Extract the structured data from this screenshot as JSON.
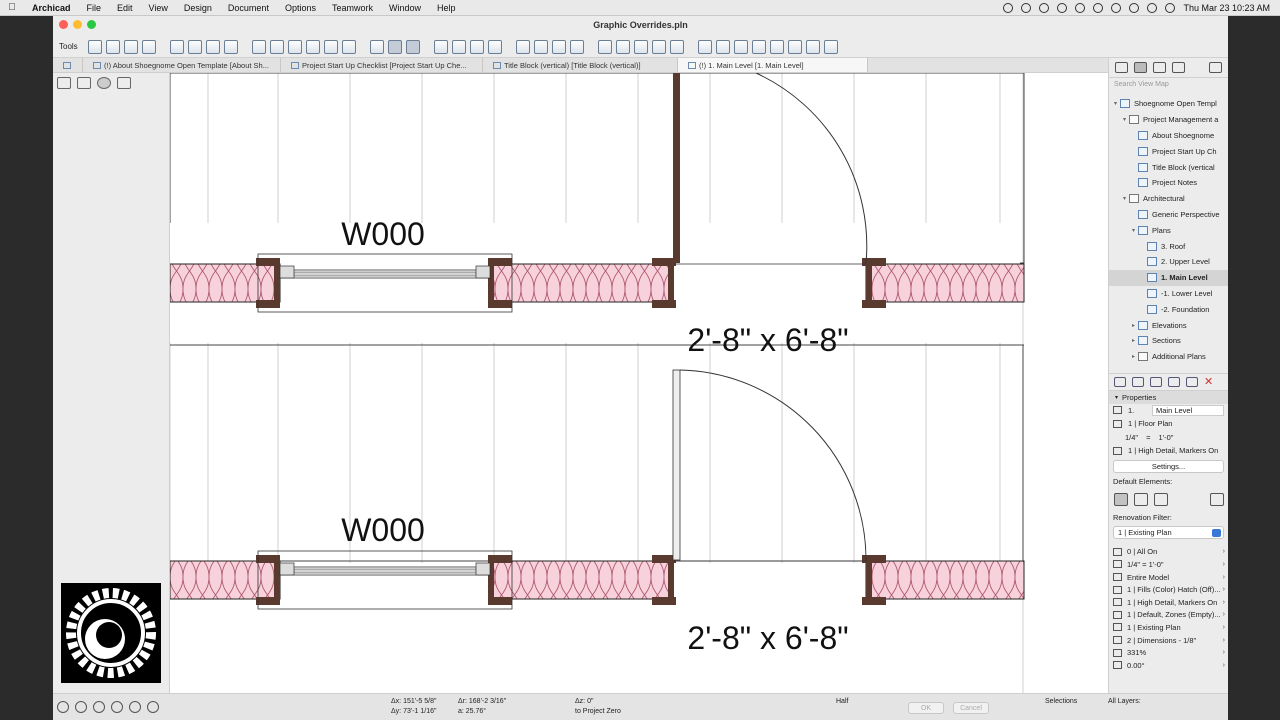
{
  "menubar": {
    "app": "Archicad",
    "items": [
      "File",
      "Edit",
      "View",
      "Design",
      "Document",
      "Options",
      "Teamwork",
      "Window",
      "Help"
    ],
    "clock": "Thu Mar 23  10:23 AM"
  },
  "window": {
    "title": "Graphic Overrides.pln"
  },
  "toolbar": {
    "tools_label": "Tools"
  },
  "tabs": [
    "(!) About Shoegnome Open Template [About Sh...",
    "Project Start Up Checklist [Project Start Up Che...",
    "Title Block (vertical) [Title Block (vertical)]",
    "(!) 1. Main Level [1. Main Level]"
  ],
  "canvas": {
    "window_labels": [
      "W000",
      "W000"
    ],
    "door_labels": [
      "2'-8\" x 6'-8\"",
      "2'-8\" x 6'-8\""
    ]
  },
  "navigator": {
    "search_placeholder": "Search View Map",
    "tree": [
      {
        "label": "Shoegnome Open Templ",
        "indent": 0,
        "twisty": "▾",
        "kind": "map"
      },
      {
        "label": "Project Management a",
        "indent": 1,
        "twisty": "▾",
        "kind": "folder"
      },
      {
        "label": "About Shoegnome",
        "indent": 2,
        "twisty": "",
        "kind": "view"
      },
      {
        "label": "Project Start Up Ch",
        "indent": 2,
        "twisty": "",
        "kind": "view"
      },
      {
        "label": "Title Block (vertical",
        "indent": 2,
        "twisty": "",
        "kind": "view"
      },
      {
        "label": "Project Notes",
        "indent": 2,
        "twisty": "",
        "kind": "view"
      },
      {
        "label": "Architectural",
        "indent": 1,
        "twisty": "▾",
        "kind": "folder"
      },
      {
        "label": "Generic Perspective",
        "indent": 2,
        "twisty": "",
        "kind": "view"
      },
      {
        "label": "Plans",
        "indent": 2,
        "twisty": "▾",
        "kind": "view"
      },
      {
        "label": "3. Roof",
        "indent": 3,
        "twisty": "",
        "kind": "view"
      },
      {
        "label": "2. Upper Level",
        "indent": 3,
        "twisty": "",
        "kind": "view"
      },
      {
        "label": "1. Main Level",
        "indent": 3,
        "twisty": "",
        "kind": "view",
        "selected": true
      },
      {
        "label": "-1. Lower Level",
        "indent": 3,
        "twisty": "",
        "kind": "view"
      },
      {
        "label": "-2. Foundation",
        "indent": 3,
        "twisty": "",
        "kind": "view"
      },
      {
        "label": "Elevations",
        "indent": 2,
        "twisty": "▸",
        "kind": "view"
      },
      {
        "label": "Sections",
        "indent": 2,
        "twisty": "▸",
        "kind": "view"
      },
      {
        "label": "Additional Plans",
        "indent": 2,
        "twisty": "▸",
        "kind": "folder"
      }
    ],
    "properties": {
      "header": "Properties",
      "id": "1.",
      "name": "Main Level",
      "view_type": "1 | Floor Plan",
      "scale_a": "1/4\"",
      "scale_eq": "=",
      "scale_b": "1'-0\"",
      "detail": "1 | High Detail, Markers On",
      "settings_label": "Settings...",
      "default_elements_label": "Default Elements:",
      "renovation_label": "Renovation Filter:",
      "renovation_value": "1 | Existing Plan"
    },
    "quick_options": [
      "0 | All On",
      "1/4\"   =   1'-0\"",
      "Entire Model",
      "1 | Fills (Color) Hatch (Off)...",
      "1 | High Detail, Markers On",
      "1 | Default, Zones (Empty)...",
      "1 | Existing Plan",
      "2 | Dimensions - 1/8\"",
      "331%",
      "0.00°"
    ]
  },
  "statusbar": {
    "dx": "Δx: 151'-5 5/8\"",
    "dy": "Δy: 73'-1 1/16\"",
    "dr": "Δr: 168'-2 3/16\"",
    "da": "a: 25.76°",
    "dz": "Δz: 0\"",
    "ref": "to Project Zero",
    "half": "Half",
    "ok": "OK",
    "cancel": "Cancel",
    "selections": "Selections",
    "all_layers": "All Layers:"
  }
}
